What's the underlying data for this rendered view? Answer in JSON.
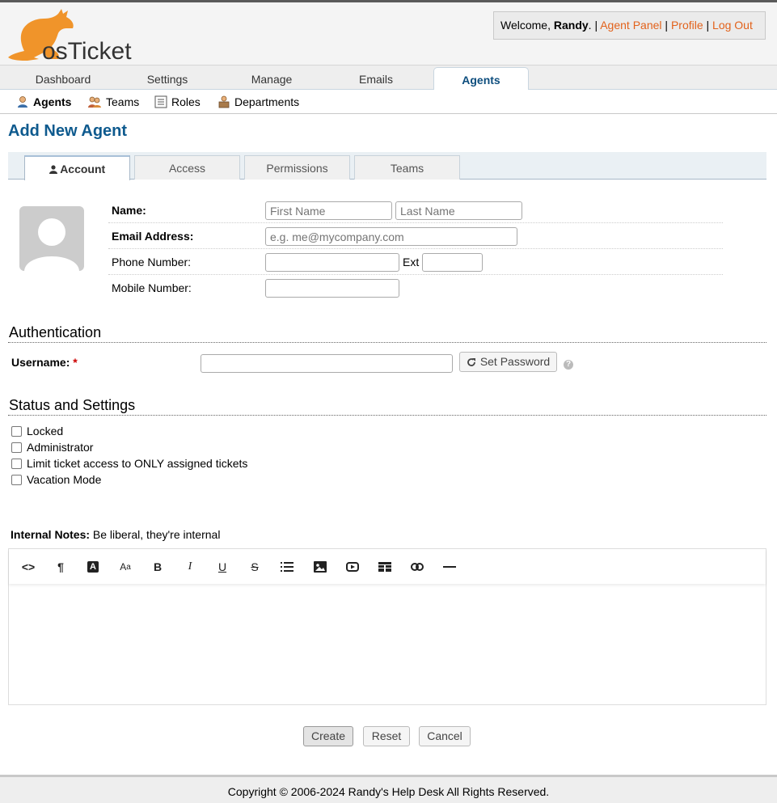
{
  "header": {
    "logo_text": "osTicket",
    "welcome_prefix": "Welcome,",
    "user_name": "Randy",
    "links": [
      "Agent Panel",
      "Profile",
      "Log Out"
    ],
    "link_color": "#e2621b"
  },
  "main_nav": {
    "tabs": [
      "Dashboard",
      "Settings",
      "Manage",
      "Emails",
      "Agents"
    ],
    "active": "Agents"
  },
  "sub_nav": {
    "items": [
      "Agents",
      "Teams",
      "Roles",
      "Departments"
    ],
    "active": "Agents"
  },
  "page": {
    "title": "Add New Agent"
  },
  "form_tabs": {
    "tabs": [
      "Account",
      "Access",
      "Permissions",
      "Teams"
    ],
    "active": "Account"
  },
  "account": {
    "name_label": "Name:",
    "first_name_placeholder": "First Name",
    "last_name_placeholder": "Last Name",
    "email_label": "Email Address:",
    "email_placeholder": "e.g. me@mycompany.com",
    "phone_label": "Phone Number:",
    "ext_label": "Ext",
    "mobile_label": "Mobile Number:"
  },
  "authentication": {
    "heading": "Authentication",
    "username_label": "Username:",
    "required_mark": "*",
    "set_password_label": "Set Password"
  },
  "status": {
    "heading": "Status and Settings",
    "checkboxes": [
      "Locked",
      "Administrator",
      "Limit ticket access to ONLY assigned tickets",
      "Vacation Mode"
    ]
  },
  "notes": {
    "label": "Internal Notes:",
    "hint": "Be liberal, they're internal",
    "toolbar_icons": [
      "code-view-icon",
      "paragraph-icon",
      "font-color-icon",
      "font-size-icon",
      "bold-icon",
      "italic-icon",
      "underline-icon",
      "strikethrough-icon",
      "list-icon",
      "image-icon",
      "video-icon",
      "table-icon",
      "link-icon",
      "horizontal-rule-icon"
    ]
  },
  "actions": {
    "create": "Create",
    "reset": "Reset",
    "cancel": "Cancel"
  },
  "footer": {
    "text": "Copyright © 2006-2024 Randy's Help Desk All Rights Reserved."
  }
}
